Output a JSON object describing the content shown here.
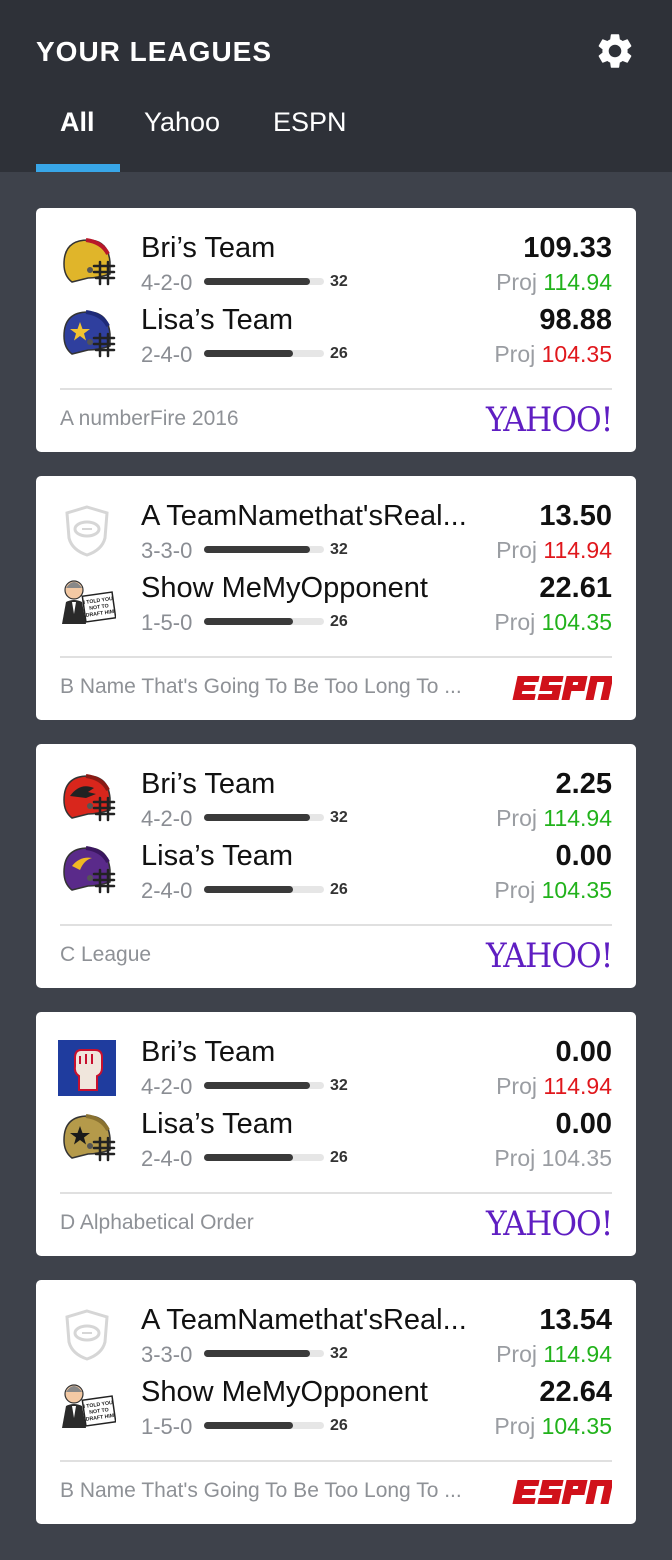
{
  "header": {
    "title": "YOUR LEAGUES",
    "settings_icon": "gear-icon",
    "tabs": [
      {
        "label": "All",
        "active": true
      },
      {
        "label": "Yahoo",
        "active": false
      },
      {
        "label": "ESPN",
        "active": false
      }
    ]
  },
  "colors": {
    "header_bg": "#2e3138",
    "page_bg": "#3e424b",
    "tab_underline": "#38a6e8",
    "proj_green": "#21b21b",
    "proj_red": "#e0171c",
    "yahoo_purple": "#5f1ec2",
    "espn_red": "#d0111a"
  },
  "leagues": [
    {
      "league_name": "A numberFire 2016",
      "platform": "YAHOO!",
      "teams": [
        {
          "name": "Bri’s Team",
          "record": "4-2-0",
          "bar_value": "32",
          "bar_fraction": 0.88,
          "score": "109.33",
          "proj_label": "Proj",
          "proj": "114.94",
          "proj_color": "green",
          "logo_icon": "gold-red-helmet-icon"
        },
        {
          "name": "Lisa’s Team",
          "record": "2-4-0",
          "bar_value": "26",
          "bar_fraction": 0.74,
          "score": "98.88",
          "proj_label": "Proj",
          "proj": "104.35",
          "proj_color": "red",
          "logo_icon": "blue-star-helmet-icon"
        }
      ]
    },
    {
      "league_name": "B Name That's Going To Be Too Long To ...",
      "platform": "ESPN",
      "teams": [
        {
          "name": "A TeamNamethat'sReal...",
          "record": "3-3-0",
          "bar_value": "32",
          "bar_fraction": 0.88,
          "score": "13.50",
          "proj_label": "Proj",
          "proj": "114.94",
          "proj_color": "red",
          "logo_icon": "football-shield-icon"
        },
        {
          "name": "Show MeMyOpponent",
          "record": "1-5-0",
          "bar_value": "26",
          "bar_fraction": 0.74,
          "score": "22.61",
          "proj_label": "Proj",
          "proj": "104.35",
          "proj_color": "green",
          "logo_icon": "man-with-sign-icon",
          "logo_sign_text": [
            "I TOLD YOU",
            "NOT TO",
            "DRAFT HIM"
          ]
        }
      ]
    },
    {
      "league_name": "C League",
      "platform": "YAHOO!",
      "teams": [
        {
          "name": "Bri’s Team",
          "record": "4-2-0",
          "bar_value": "32",
          "bar_fraction": 0.88,
          "score": "2.25",
          "proj_label": "Proj",
          "proj": "114.94",
          "proj_color": "green",
          "logo_icon": "red-helmet-icon"
        },
        {
          "name": "Lisa’s Team",
          "record": "2-4-0",
          "bar_value": "26",
          "bar_fraction": 0.74,
          "score": "0.00",
          "proj_label": "Proj",
          "proj": "104.35",
          "proj_color": "green",
          "logo_icon": "purple-gold-helmet-icon"
        }
      ]
    },
    {
      "league_name": "D Alphabetical Order",
      "platform": "YAHOO!",
      "teams": [
        {
          "name": "Bri’s Team",
          "record": "4-2-0",
          "bar_value": "32",
          "bar_fraction": 0.88,
          "score": "0.00",
          "proj_label": "Proj",
          "proj": "114.94",
          "proj_color": "red",
          "logo_icon": "raised-fist-icon"
        },
        {
          "name": "Lisa’s Team",
          "record": "2-4-0",
          "bar_value": "26",
          "bar_fraction": 0.74,
          "score": "0.00",
          "proj_label": "Proj",
          "proj": "104.35",
          "proj_color": "gray",
          "logo_icon": "gold-star-helmet-icon"
        }
      ]
    },
    {
      "league_name": "B Name That's Going To Be Too Long To ...",
      "platform": "ESPN",
      "teams": [
        {
          "name": "A TeamNamethat'sReal...",
          "record": "3-3-0",
          "bar_value": "32",
          "bar_fraction": 0.88,
          "score": "13.54",
          "proj_label": "Proj",
          "proj": "114.94",
          "proj_color": "green",
          "logo_icon": "football-shield-icon"
        },
        {
          "name": "Show MeMyOpponent",
          "record": "1-5-0",
          "bar_value": "26",
          "bar_fraction": 0.74,
          "score": "22.64",
          "proj_label": "Proj",
          "proj": "104.35",
          "proj_color": "green",
          "logo_icon": "man-with-sign-icon",
          "logo_sign_text": [
            "I TOLD YOU",
            "NOT TO",
            "DRAFT HIM"
          ]
        }
      ]
    }
  ]
}
